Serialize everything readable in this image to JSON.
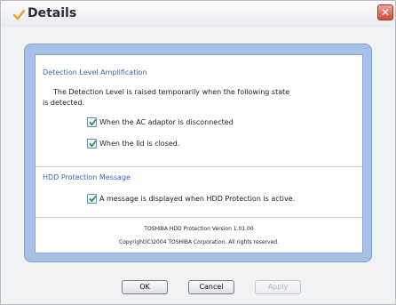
{
  "window": {
    "title": "Details",
    "close_glyph": "✕"
  },
  "detection": {
    "group_label": "Detection Level Amplification",
    "description_line1": "The Detection Level is raised temporarily when the following state",
    "description_line2": "is detected.",
    "checkbox_ac_label": "When the AC adaptor is disconnected",
    "checkbox_lid_label": "When the lid is closed."
  },
  "message": {
    "group_label": "HDD Protection Message",
    "checkbox_label": "A message is displayed when HDD Protection is active."
  },
  "footer": {
    "version": "TOSHIBA HDD Protection Version 1.01.00",
    "copyright": "Copyright(C)2004 TOSHIBA Corporation. All rights reserved."
  },
  "buttons": {
    "ok": "OK",
    "cancel": "Cancel",
    "apply": "Apply"
  },
  "colors": {
    "accent": "#3b64b8",
    "frame": "#a7c0e8"
  }
}
